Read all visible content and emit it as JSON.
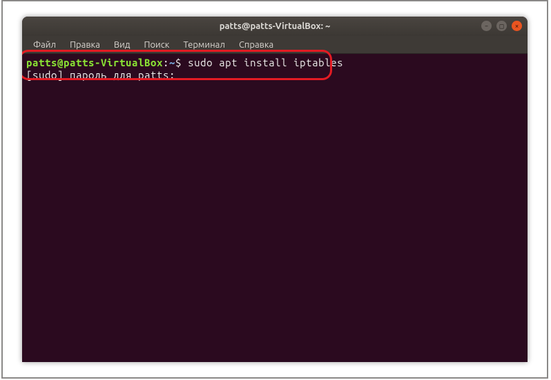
{
  "window": {
    "title": "patts@patts-VirtualBox: ~"
  },
  "menubar": {
    "items": [
      {
        "label": "Файл"
      },
      {
        "label": "Правка"
      },
      {
        "label": "Вид"
      },
      {
        "label": "Поиск"
      },
      {
        "label": "Терминал"
      },
      {
        "label": "Справка"
      }
    ]
  },
  "terminal": {
    "prompt": {
      "user_host": "patts@patts-VirtualBox",
      "colon": ":",
      "cwd": "~",
      "dollar": "$ "
    },
    "command": "sudo apt install iptables",
    "sudo_prompt": "[sudo] пароль для patts: "
  },
  "controls": {
    "min_glyph": "–",
    "max_glyph": "□",
    "close_glyph": "×"
  }
}
